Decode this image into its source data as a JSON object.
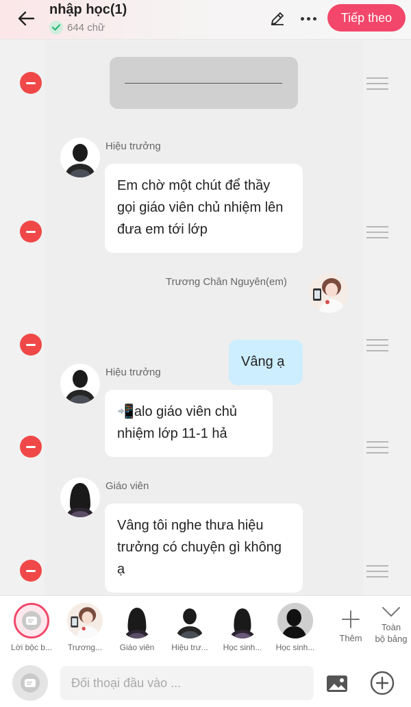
{
  "header": {
    "title": "nhập học(1)",
    "word_count": "644 chữ",
    "next_label": "Tiếp theo"
  },
  "messages": [
    {
      "speaker": "Hiệu trưởng",
      "text": "Em chờ một chút để thầy gọi giáo viên chủ nhiệm lên đưa em tới lớp"
    },
    {
      "speaker": "Trương Chân Nguyên(em)",
      "text": "Vâng ạ"
    },
    {
      "speaker": "Hiệu trưởng",
      "text": "📲alo giáo viên chủ nhiệm lớp 11-1 hả"
    },
    {
      "speaker": "Giáo viên",
      "text": "Vâng tôi nghe thưa hiệu trưởng có chuyện gì không ạ"
    }
  ],
  "characters": [
    {
      "label": "Lời bộc b..."
    },
    {
      "label": "Trương..."
    },
    {
      "label": "Giáo viên"
    },
    {
      "label": "Hiệu trư..."
    },
    {
      "label": "Học sinh..."
    },
    {
      "label": "Học sinh..."
    }
  ],
  "charbar": {
    "add_label": "Thêm",
    "expand_label_1": "Toàn",
    "expand_label_2": "bộ bảng"
  },
  "input": {
    "placeholder": "Đối thoại đầu vào ..."
  },
  "colors": {
    "accent": "#f2476a",
    "delete": "#f04848",
    "my_bubble": "#cdeeff"
  }
}
